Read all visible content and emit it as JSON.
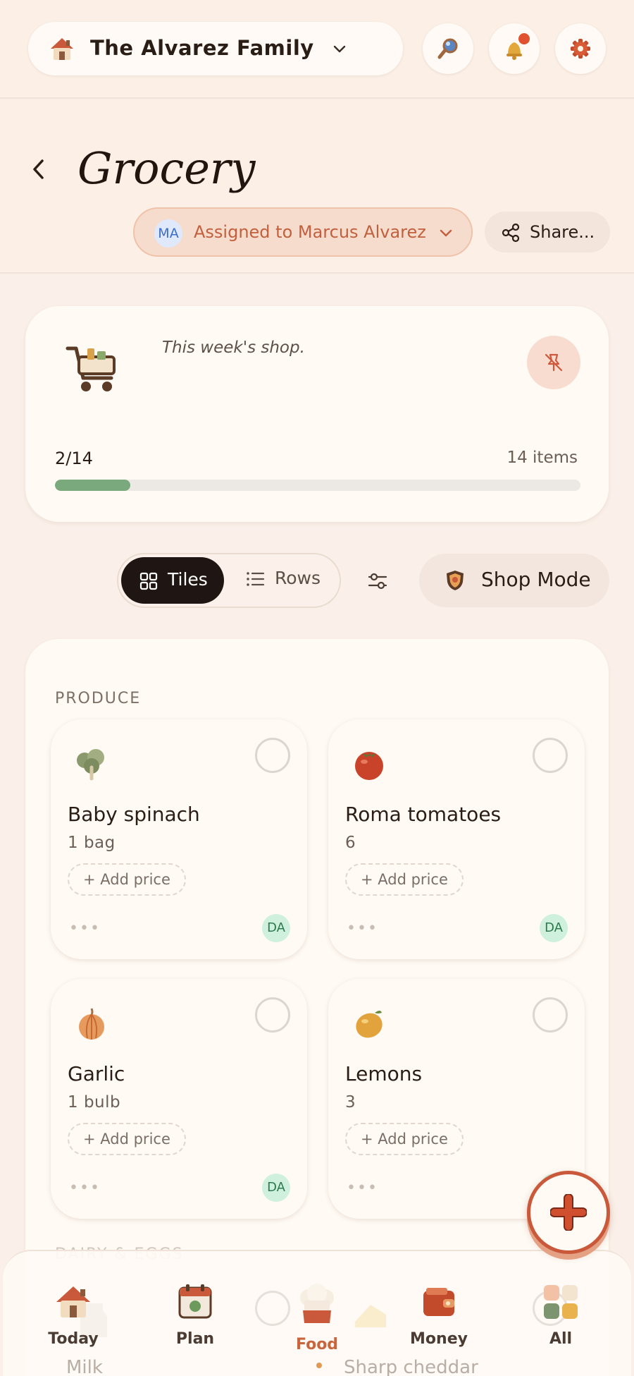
{
  "topbar": {
    "family_name": "The Alvarez Family",
    "icons": [
      "house-icon",
      "chevron-down-icon",
      "search-icon",
      "bell-icon",
      "gear-icon"
    ]
  },
  "header": {
    "title": "Grocery",
    "assignee_initials": "MA",
    "assigned_label": "Assigned to Marcus Alvarez",
    "share_label": "Share..."
  },
  "summary": {
    "description": "This week's shop.",
    "progress_text": "2/14",
    "items_count": "14 items",
    "progress_fraction": 0.143
  },
  "view": {
    "tiles_label": "Tiles",
    "rows_label": "Rows",
    "shop_mode_label": "Shop Mode",
    "selected": "Tiles"
  },
  "sections": [
    {
      "label": "PRODUCE",
      "items": [
        {
          "name": "Baby spinach",
          "qty": "1 bag",
          "price_label": "+ Add price",
          "badge": "DA",
          "icon": "spinach-icon"
        },
        {
          "name": "Roma tomatoes",
          "qty": "6",
          "price_label": "+ Add price",
          "badge": "DA",
          "icon": "tomato-icon"
        },
        {
          "name": "Garlic",
          "qty": "1 bulb",
          "price_label": "+ Add price",
          "badge": "DA",
          "icon": "garlic-icon"
        },
        {
          "name": "Lemons",
          "qty": "3",
          "price_label": "+ Add price",
          "badge": "DA",
          "icon": "lemon-icon"
        }
      ]
    },
    {
      "label": "DAIRY & EGGS",
      "items": [
        {
          "name": "Milk",
          "icon": "milk-icon"
        },
        {
          "name": "Sharp cheddar",
          "icon": "cheese-icon"
        }
      ]
    }
  ],
  "nav": [
    {
      "label": "Today",
      "icon": "house-icon"
    },
    {
      "label": "Plan",
      "icon": "calendar-icon"
    },
    {
      "label": "Food",
      "icon": "chef-hat-icon",
      "active": true
    },
    {
      "label": "Money",
      "icon": "wallet-icon"
    },
    {
      "label": "All",
      "icon": "grid-icon"
    }
  ],
  "colors": {
    "accent": "#c8653d",
    "progress": "#79a97c",
    "background": "#faf0e9",
    "badge_bg": "#cff0dc"
  }
}
